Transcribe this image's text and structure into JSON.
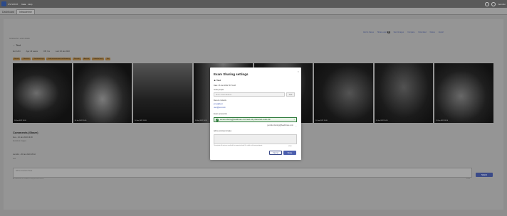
{
  "topbar": {
    "brand": "CS SONIX",
    "tag": "beta",
    "extra": "Help",
    "user": "Jennifer"
  },
  "tabs": [
    {
      "label": "Dashboard"
    },
    {
      "label": "Intrauterine",
      "active": true
    }
  ],
  "breadcrumb": "Intrauterine / exam details",
  "toolbar": {
    "items": [
      "Add to Cases",
      "Share exam",
      "Send images",
      "Compare",
      "Download",
      "Delete",
      "Export"
    ],
    "share_count": "0"
  },
  "exam": {
    "back_label": "Test",
    "meta": [
      "Ext: 1234",
      "Age: 29 weeks",
      "OB: Yes",
      "Last: 26 Jan 2022"
    ],
    "tags": [
      "Normal",
      "Obstetrics",
      "Gestational age",
      "Fetal measurements and biometry",
      "Placenta",
      "Amniotic",
      "Umbilical cord",
      "Sex"
    ]
  },
  "gallery": {
    "images": [
      {
        "label": "10 Jan 2022 19:20"
      },
      {
        "label": "10 Jan 2022 19:20"
      },
      {
        "label": "10 Jan 2022 19:20"
      },
      {
        "label": "10 Jan 2022 19:20"
      },
      {
        "label": "10 Jan 2022 19:20"
      },
      {
        "label": "10 Jan 2022 19:20"
      },
      {
        "label": "10 Jan 2022 19:20"
      },
      {
        "label": "10 Jan 2022 19:20"
      }
    ]
  },
  "comments": {
    "title": "Comments (Share)",
    "commenter": "Alex - 10 Jan 2022 19:20",
    "commenter_note": "Excellent images",
    "author": "Jennifer - 26 Jan 2022 16:32",
    "sub": "test",
    "placeholder": "Add a comment here",
    "hint": "All comments are visible to everyone with access",
    "count": "0/500",
    "submit_label": "Submit"
  },
  "modal": {
    "title": "Exam Sharing settings",
    "owner": "Test",
    "date": "Date: 26 Jan 2022   ID: Test3",
    "invite_label": "Invite people",
    "invite_placeholder": "Enter email address",
    "add_label": "Add",
    "recent_label": "Recent contacts",
    "recent": [
      "jones@test",
      "user@test.com"
    ],
    "access_label": "Exam access list",
    "access_entry": "access.sharing@healthcare.com/read-only-share/test-exam-link",
    "access_email": "jennifer.sharing@healthcare.com",
    "comment_label": "Add a comment (note)",
    "note": "The recipient will receive an email with the comment included. It is visible to all exam participants.",
    "counter": "0/500",
    "cancel_label": "Cancel",
    "share_label": "Share"
  }
}
